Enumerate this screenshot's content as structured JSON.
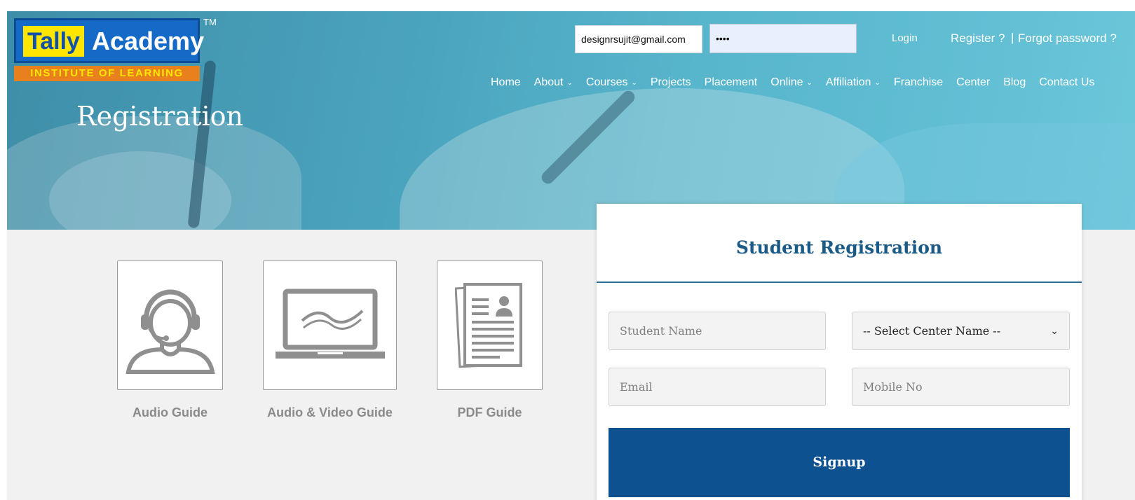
{
  "logo": {
    "word1": "Tally",
    "word2": "Academy",
    "tagline": "INSTITUTE OF LEARNING",
    "tm": "TM"
  },
  "login": {
    "email_value": "designrsujit@gmail.com",
    "password_value": "••••",
    "login_label": "Login",
    "register_label": "Register ?",
    "separator": "|",
    "forgot_label": "Forgot password ?"
  },
  "nav": {
    "items": [
      {
        "label": "Home",
        "dropdown": false
      },
      {
        "label": "About",
        "dropdown": true
      },
      {
        "label": "Courses",
        "dropdown": true
      },
      {
        "label": "Projects",
        "dropdown": false
      },
      {
        "label": "Placement",
        "dropdown": false
      },
      {
        "label": "Online",
        "dropdown": true
      },
      {
        "label": "Affiliation",
        "dropdown": true
      },
      {
        "label": "Franchise",
        "dropdown": false
      },
      {
        "label": "Center",
        "dropdown": false
      },
      {
        "label": "Blog",
        "dropdown": false
      },
      {
        "label": "Contact Us",
        "dropdown": false
      }
    ]
  },
  "page": {
    "title": "Registration"
  },
  "guides": [
    {
      "label": "Audio Guide",
      "icon": "headset-user-icon"
    },
    {
      "label": "Audio & Video Guide",
      "icon": "laptop-video-icon"
    },
    {
      "label": "PDF Guide",
      "icon": "pdf-document-icon"
    }
  ],
  "form": {
    "title": "Student Registration",
    "name_placeholder": "Student Name",
    "center_selected": "-- Select Center Name --",
    "email_placeholder": "Email",
    "mobile_placeholder": "Mobile No",
    "signup_label": "Signup"
  },
  "colors": {
    "brand_blue": "#0e5190",
    "title_blue": "#1a5a86",
    "hero": "#4aa3bd",
    "logo_yellow": "#ffe600",
    "logo_orange": "#e8801e"
  }
}
